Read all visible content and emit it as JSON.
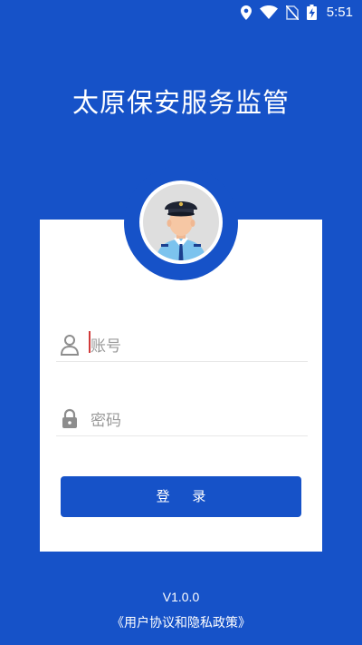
{
  "status_bar": {
    "time": "5:51",
    "icons": [
      "location-icon",
      "wifi-icon",
      "no-sim-icon",
      "battery-charging-icon"
    ]
  },
  "app": {
    "title": "太原保安服务监管"
  },
  "login": {
    "account_placeholder": "账号",
    "password_placeholder": "密码",
    "submit_label": "登 录"
  },
  "footer": {
    "version": "V1.0.0",
    "policy_link": "《用户协议和隐私政策》"
  },
  "colors": {
    "brand_blue": "#1652C8",
    "card": "#FFFFFF",
    "placeholder": "#9A9A9A",
    "icon": "#8D8D8D"
  }
}
